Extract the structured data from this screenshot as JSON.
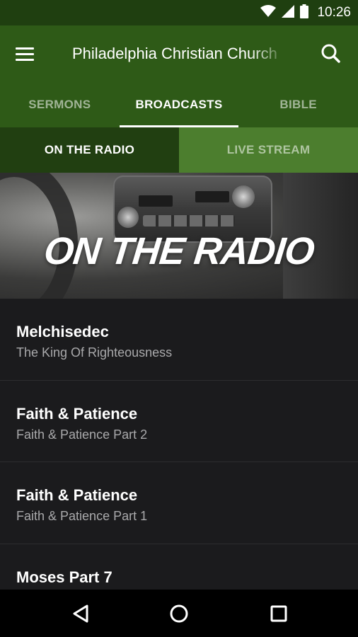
{
  "status_bar": {
    "time": "10:26"
  },
  "app_bar": {
    "title": "Philadelphia Christian Church"
  },
  "tabs": [
    {
      "label": "SERMONS",
      "active": false
    },
    {
      "label": "BROADCASTS",
      "active": true
    },
    {
      "label": "BIBLE",
      "active": false
    }
  ],
  "segments": [
    {
      "label": "ON THE RADIO",
      "active": true
    },
    {
      "label": "LIVE STREAM",
      "active": false
    }
  ],
  "banner": {
    "title": "ON THE RADIO"
  },
  "items": [
    {
      "title": "Melchisedec",
      "subtitle": "The King Of Righteousness"
    },
    {
      "title": "Faith & Patience",
      "subtitle": "Faith & Patience Part 2"
    },
    {
      "title": "Faith & Patience",
      "subtitle": "Faith & Patience Part 1"
    },
    {
      "title": "Moses Part 7",
      "subtitle": ""
    }
  ],
  "icons": {
    "wifi": "wifi-icon",
    "signal": "signal-icon",
    "battery": "battery-icon",
    "menu": "menu-icon",
    "search": "search-icon",
    "back": "back-icon",
    "home": "home-icon",
    "recents": "recents-icon"
  },
  "colors": {
    "status_bar": "#1f3f10",
    "app_bar": "#2e5a17",
    "segment_active": "#213f11",
    "segment_inactive": "#4c7e2e",
    "list_background": "#1b1b1d"
  }
}
